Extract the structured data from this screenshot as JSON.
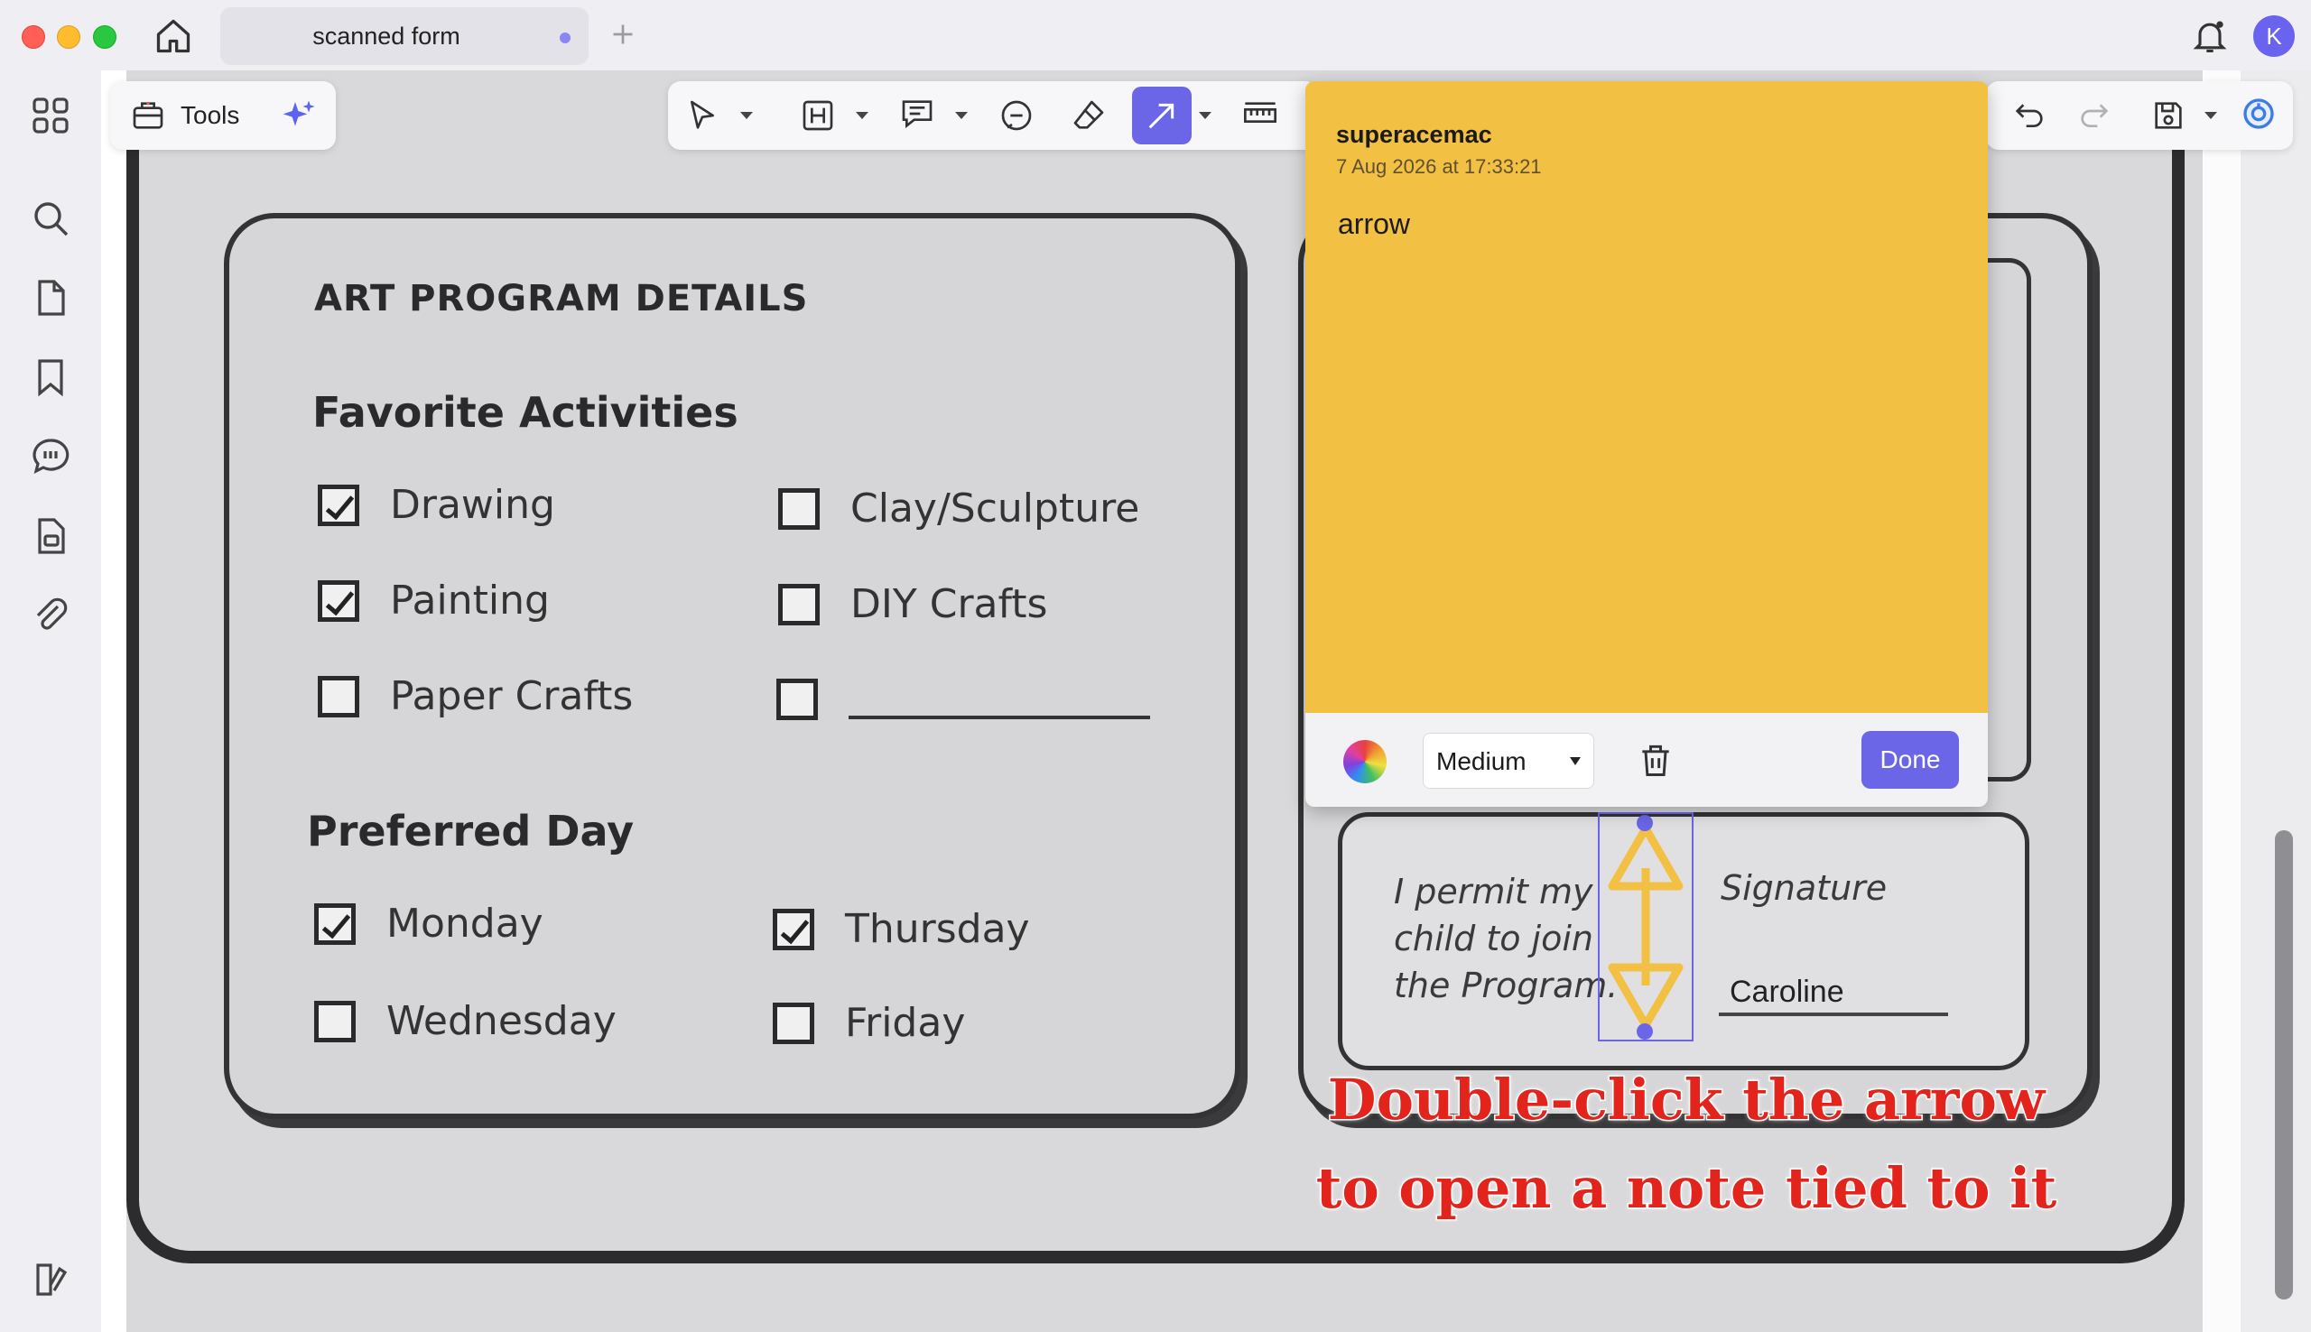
{
  "window": {
    "tab_title": "scanned form",
    "avatar_initial": "K"
  },
  "toolbar": {
    "tools_label": "Tools",
    "active_tool": "arrow",
    "accent_color": "#6b66e8"
  },
  "form": {
    "title": "ART PROGRAM DETAILS",
    "favorite_heading": "Favorite Activities",
    "activities": [
      {
        "label": "Drawing",
        "checked": true
      },
      {
        "label": "Clay/Sculpture",
        "checked": false
      },
      {
        "label": "Painting",
        "checked": true
      },
      {
        "label": "DIY Crafts",
        "checked": false
      },
      {
        "label": "Paper Crafts",
        "checked": false
      },
      {
        "label": "",
        "checked": false
      }
    ],
    "day_heading": "Preferred Day",
    "days": [
      {
        "label": "Monday",
        "checked": true
      },
      {
        "label": "Thursday",
        "checked": true
      },
      {
        "label": "Wednesday",
        "checked": false
      },
      {
        "label": "Friday",
        "checked": false
      }
    ],
    "permit_lines": [
      "I permit my",
      "child to join",
      "the Program."
    ],
    "signature_label": "Signature",
    "signature_value": "Caroline"
  },
  "note": {
    "author": "superacemac",
    "timestamp": "7 Aug 2026 at 17:33:21",
    "body": "arrow",
    "color": "#f2c043",
    "size_value": "Medium",
    "done_label": "Done"
  },
  "caption": {
    "line1": "Double-click the arrow",
    "line2": "to open a note tied to it"
  }
}
